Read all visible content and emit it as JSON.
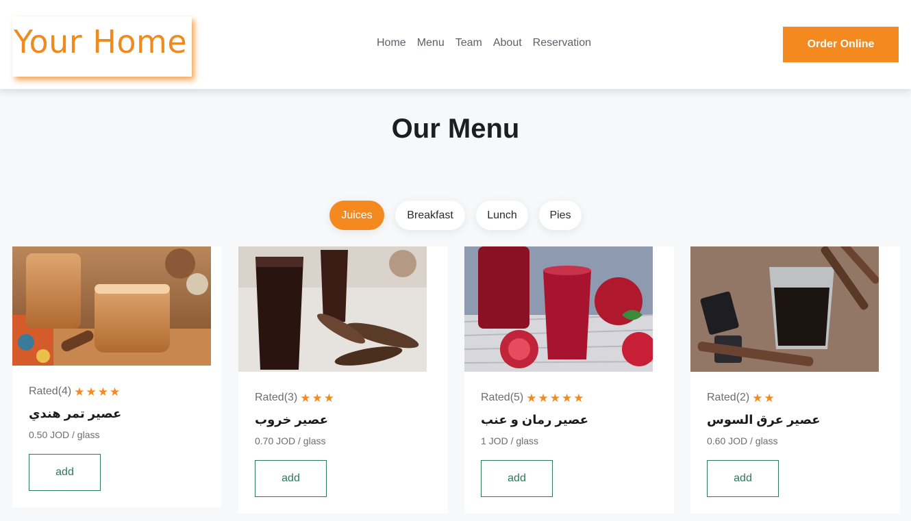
{
  "brand": {
    "logo_text": "Your Home"
  },
  "nav": {
    "items": [
      "Home",
      "Menu",
      "Team",
      "About",
      "Reservation"
    ]
  },
  "header": {
    "order_label": "Order Online"
  },
  "section": {
    "title": "Our Menu"
  },
  "tabs": [
    {
      "label": "Juices",
      "active": true
    },
    {
      "label": "Breakfast",
      "active": false
    },
    {
      "label": "Lunch",
      "active": false
    },
    {
      "label": "Pies",
      "active": false
    }
  ],
  "cards": [
    {
      "rating_label": "Rated(4)",
      "stars": 4,
      "name": "عصير تمر هندي",
      "price": "0.50 JOD / glass",
      "add_label": "add"
    },
    {
      "rating_label": "Rated(3)",
      "stars": 3,
      "name": "عصير خروب",
      "price": "0.70 JOD / glass",
      "add_label": "add"
    },
    {
      "rating_label": "Rated(5)",
      "stars": 5,
      "name": "عصير رمان و عنب",
      "price": "1 JOD / glass",
      "add_label": "add"
    },
    {
      "rating_label": "Rated(2)",
      "stars": 2,
      "name": "عصير عرق السوس",
      "price": "0.60 JOD / glass",
      "add_label": "add"
    }
  ],
  "colors": {
    "accent": "#f4891f",
    "add_border": "#2a7a58",
    "background": "#f7f8fa"
  }
}
